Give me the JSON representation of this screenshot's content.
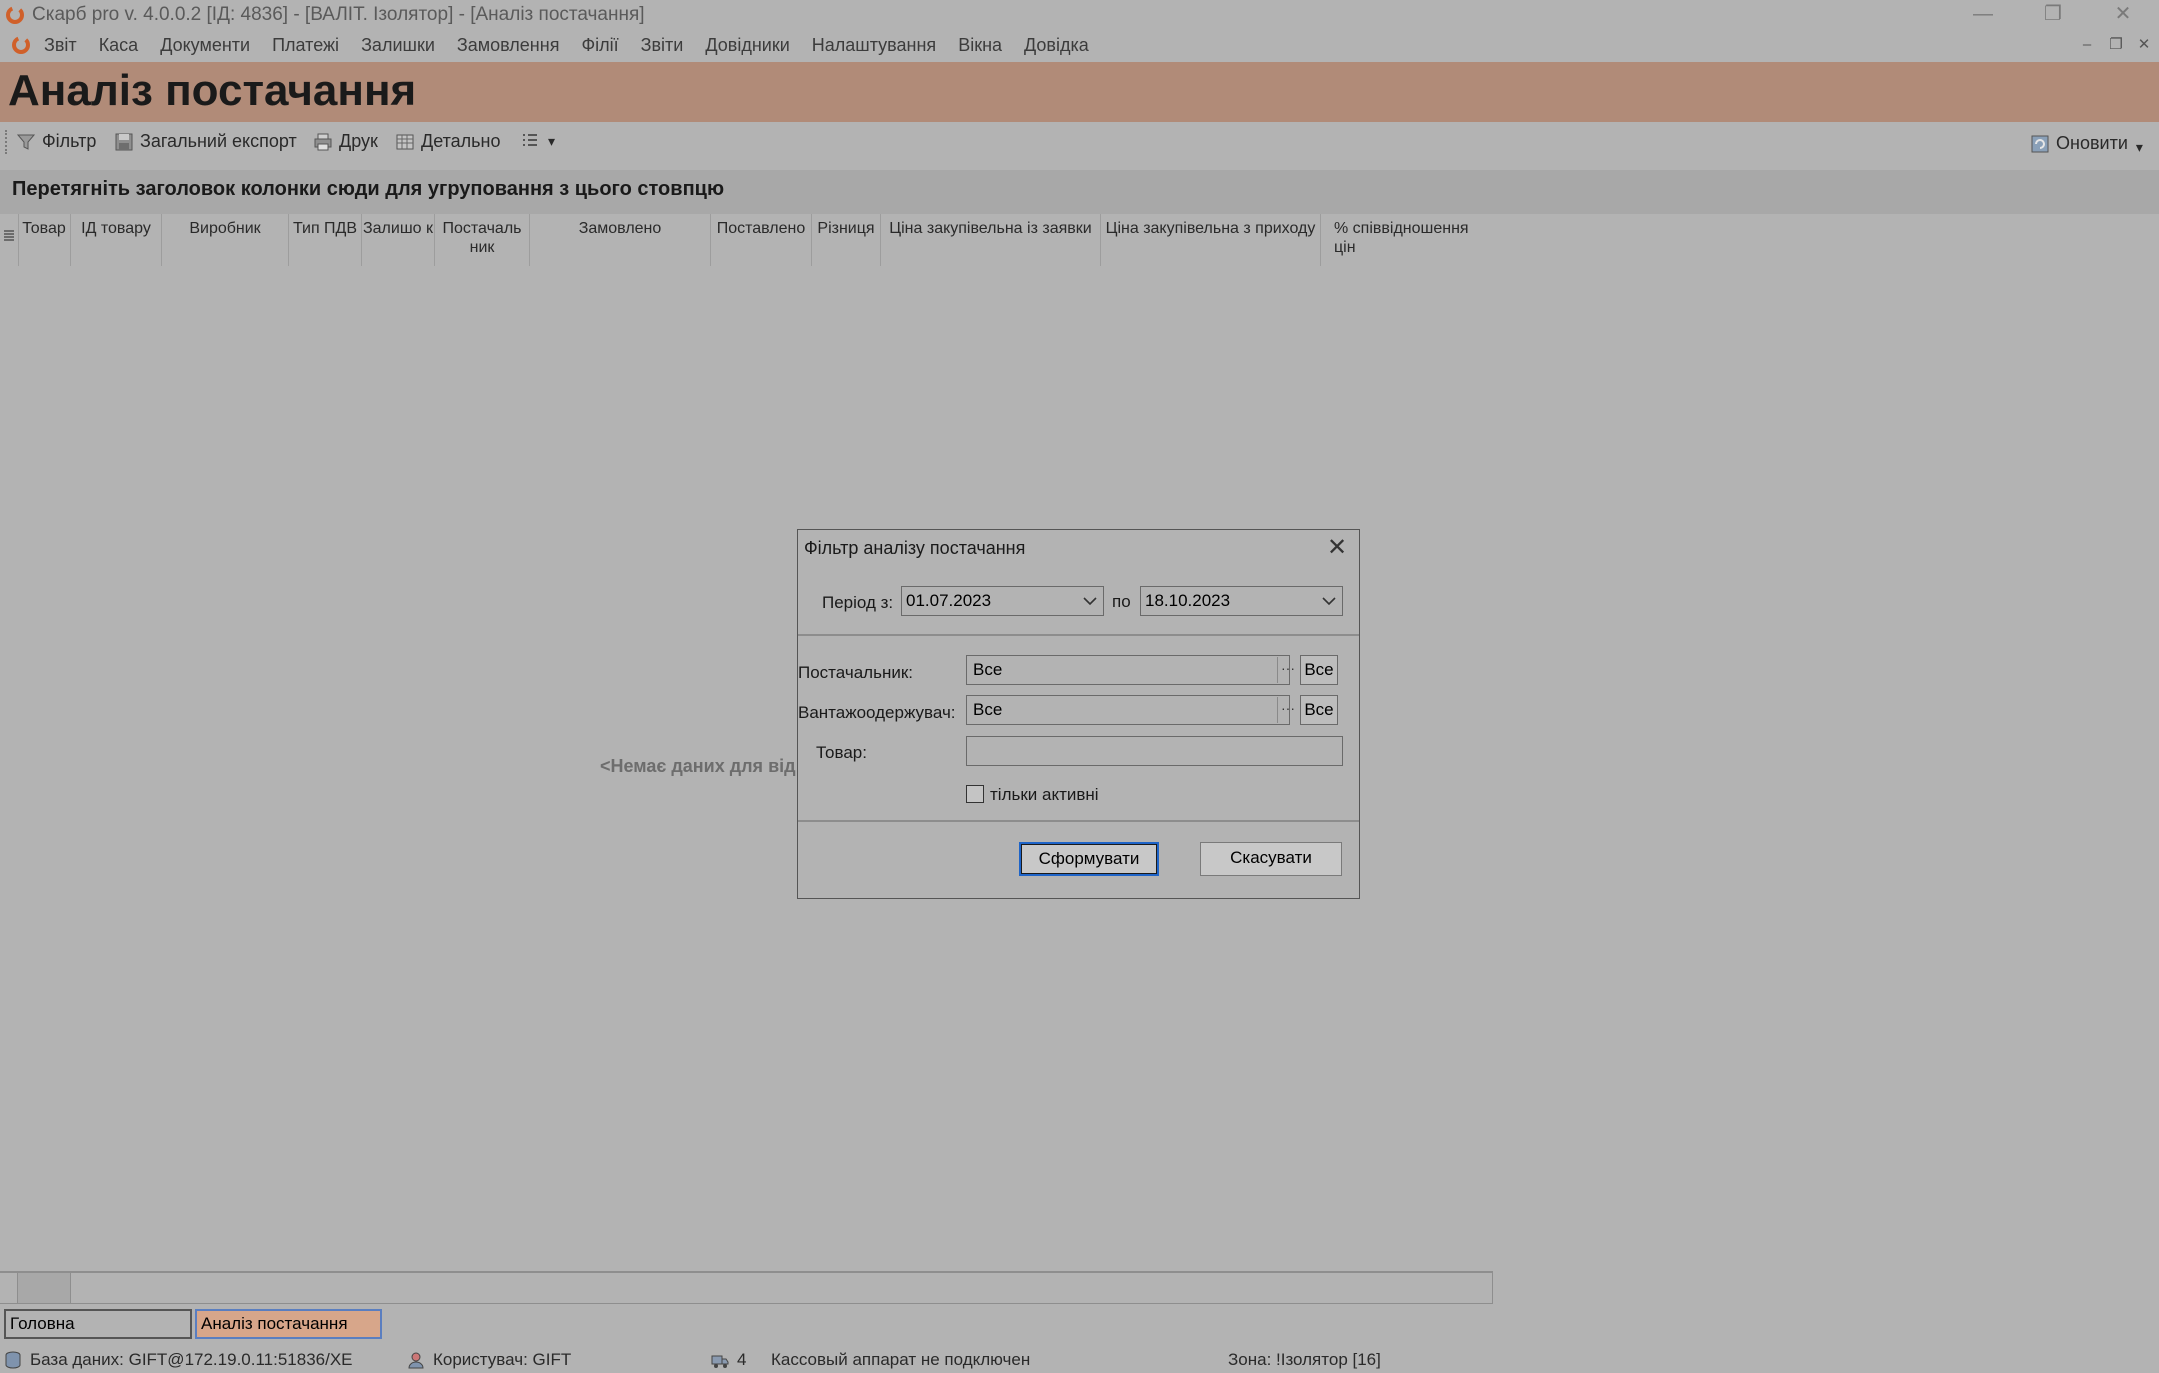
{
  "window": {
    "title": "Скарб pro v. 4.0.0.2 [ІД: 4836] - [ВАЛІТ. Ізолятор] - [Аналіз постачання]",
    "min_glyph": "—",
    "restore_glyph": "❐",
    "close_glyph": "✕"
  },
  "menu": {
    "items": [
      "Звіт",
      "Каса",
      "Документи",
      "Платежі",
      "Залишки",
      "Замовлення",
      "Філії",
      "Звіти",
      "Довідники",
      "Налаштування",
      "Вікна",
      "Довідка"
    ],
    "mdi_min": "–",
    "mdi_restore": "❐",
    "mdi_close": "✕"
  },
  "header": {
    "title": "Аналіз постачання"
  },
  "toolbar": {
    "filter": "Фільтр",
    "export": "Загальний експорт",
    "print": "Друк",
    "detail": "Детально",
    "refresh": "Оновити",
    "dropdown_glyph": "▾"
  },
  "grid": {
    "group_hint": "Перетягніть заголовок колонки сюди для угруповання з цього стовпцю",
    "columns": [
      "Товар",
      "ІД товару",
      "Виробник",
      "Тип ПДВ",
      "Залишо к",
      "Постачаль ник",
      "Замовлено",
      "Поставлено",
      "Різниця",
      "Ціна закупівельна із заявки",
      "Ціна закупівельна з приходу",
      "% співвідношення цін"
    ],
    "empty_text": "<Немає даних для від"
  },
  "dialog": {
    "title": "Фільтр аналізу постачання",
    "close_glyph": "✕",
    "period_from_label": "Період з:",
    "period_from_value": "01.07.2023",
    "period_to_label": "по",
    "period_to_value": "18.10.2023",
    "supplier_label": "Постачальник:",
    "supplier_value": "Все",
    "consignee_label": "Вантажоодержувач:",
    "consignee_value": "Все",
    "ellipsis": "···",
    "all_button": "Все",
    "product_label": "Товар:",
    "product_value": "",
    "only_active_label": "тільки активні",
    "only_active_checked": false,
    "submit_button": "Сформувати",
    "cancel_button": "Скасувати"
  },
  "tabs": [
    {
      "label": "Головна",
      "active": false
    },
    {
      "label": "Аналіз постачання",
      "active": true
    }
  ],
  "status": {
    "database": "База даних: GIFT@172.19.0.11:51836/XE",
    "user": "Користувач: GIFT",
    "count": "4",
    "cashbox": "Кассовый аппарат не подключен",
    "zone": "Зона: !Ізолятор [16]"
  },
  "colors": {
    "accent": "#b18b78",
    "background": "#b3b3b3",
    "primary_button_border": "#1e64c8",
    "app_icon": "#d0602a"
  }
}
